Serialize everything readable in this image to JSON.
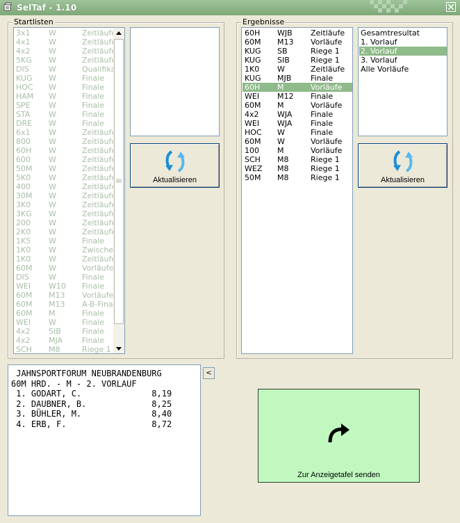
{
  "window": {
    "title": "SelTaf - 1.10"
  },
  "startlisten": {
    "label": "Startlisten",
    "rows": [
      [
        "3x1",
        "W",
        "Zeitläufe"
      ],
      [
        "4x1",
        "W",
        "Zeitläufe"
      ],
      [
        "4x2",
        "W",
        "Zeitläufe"
      ],
      [
        "5KG",
        "W",
        "Zeitläufe"
      ],
      [
        "DIS",
        "W",
        "Qualifikat"
      ],
      [
        "KUG",
        "W",
        "Finale"
      ],
      [
        "HOC",
        "W",
        "Finale"
      ],
      [
        "HAM",
        "W",
        "Finale"
      ],
      [
        "SPE",
        "W",
        "Finale"
      ],
      [
        "STA",
        "W",
        "Finale"
      ],
      [
        "DRE",
        "W",
        "Finale"
      ],
      [
        "6x1",
        "W",
        "Zeitläufe"
      ],
      [
        "800",
        "W",
        "Zeitläufe"
      ],
      [
        "60H",
        "W",
        "Zeitläufe"
      ],
      [
        "600",
        "W",
        "Zeitläufe"
      ],
      [
        "50M",
        "W",
        "Zeitläufe"
      ],
      [
        "5K0",
        "W",
        "Zeitläufe"
      ],
      [
        "400",
        "W",
        "Zeitläufe"
      ],
      [
        "30M",
        "W",
        "Zeitläufe"
      ],
      [
        "3K0",
        "W",
        "Zeitläufe"
      ],
      [
        "3KG",
        "W",
        "Zeitläufe"
      ],
      [
        "200",
        "W",
        "Zeitläufe"
      ],
      [
        "2K0",
        "W",
        "Zeitläufe"
      ],
      [
        "1K5",
        "W",
        "Finale"
      ],
      [
        "1K0",
        "W",
        "Zwischen"
      ],
      [
        "1K0",
        "W",
        "Zeitläufe"
      ],
      [
        "60M",
        "W",
        "Vorläufe"
      ],
      [
        "DIS",
        "W",
        "Finale"
      ],
      [
        "WEI",
        "W10",
        "Finale"
      ],
      [
        "60M",
        "M13",
        "Vorläufe"
      ],
      [
        "60M",
        "M13",
        "A-B-Finale"
      ],
      [
        "60M",
        "M",
        "Finale"
      ],
      [
        "WEI",
        "W",
        "Finale"
      ],
      [
        "4x2",
        "SIB",
        "Finale"
      ],
      [
        "4x2",
        "MJA",
        "Finale"
      ],
      [
        "SCH",
        "M8",
        "Riege 1"
      ]
    ],
    "refresh_label": "Aktualisieren"
  },
  "ergebnisse": {
    "label": "Ergebnisse",
    "selected_index": 6,
    "rows": [
      [
        "60H",
        "WJB",
        "Zeitläufe"
      ],
      [
        "60M",
        "M13",
        "Vorläufe"
      ],
      [
        "KUG",
        "SB",
        "Riege 1"
      ],
      [
        "KUG",
        "SIB",
        "Riege 1"
      ],
      [
        "1K0",
        "W",
        "Zeitläufe"
      ],
      [
        "KUG",
        "MJB",
        "Finale"
      ],
      [
        "60H",
        "M",
        "Vorläufe"
      ],
      [
        "WEI",
        "M12",
        "Finale"
      ],
      [
        "60M",
        "M",
        "Vorläufe"
      ],
      [
        "4x2",
        "WJA",
        "Finale"
      ],
      [
        "WEI",
        "WJA",
        "Finale"
      ],
      [
        "HOC",
        "W",
        "Finale"
      ],
      [
        "60M",
        "W",
        "Vorläufe"
      ],
      [
        "100",
        "M",
        "Vorläufe"
      ],
      [
        "SCH",
        "M8",
        "Riege 1"
      ],
      [
        "WEZ",
        "M8",
        "Riege 1"
      ],
      [
        "50M",
        "M8",
        "Riege 1"
      ]
    ],
    "runs": [
      "Gesamtresultat",
      "1. Vorlauf",
      "2. Vorlauf",
      "3. Vorlauf",
      "Alle Vorläufe"
    ],
    "runs_selected_index": 2,
    "refresh_label": "Aktualisieren"
  },
  "output": {
    "lines": [
      " JAHNSPORTFORUM NEUBRANDENBURG",
      "60M HRD. - M - 2. VORLAUF",
      " 1. GODART, C.              8,19",
      " 2. DAUBNER, B.             8,25",
      " 3. BÜHLER, M.              8,40",
      " 4. ERB, F.                 8,72"
    ],
    "collapse_label": "<"
  },
  "send": {
    "label": "Zur Anzeigetafel senden"
  },
  "colors": {
    "title_bar": "#8fb58a",
    "selection": "#8fba8a",
    "send_button": "#c0f8c0",
    "muted_text": "#a8bea6",
    "refresh_icon": "#1a8fd8"
  },
  "icons": {
    "app": "app-icon",
    "close": "close-icon",
    "refresh": "refresh-icon",
    "send": "curved-arrow-icon"
  }
}
